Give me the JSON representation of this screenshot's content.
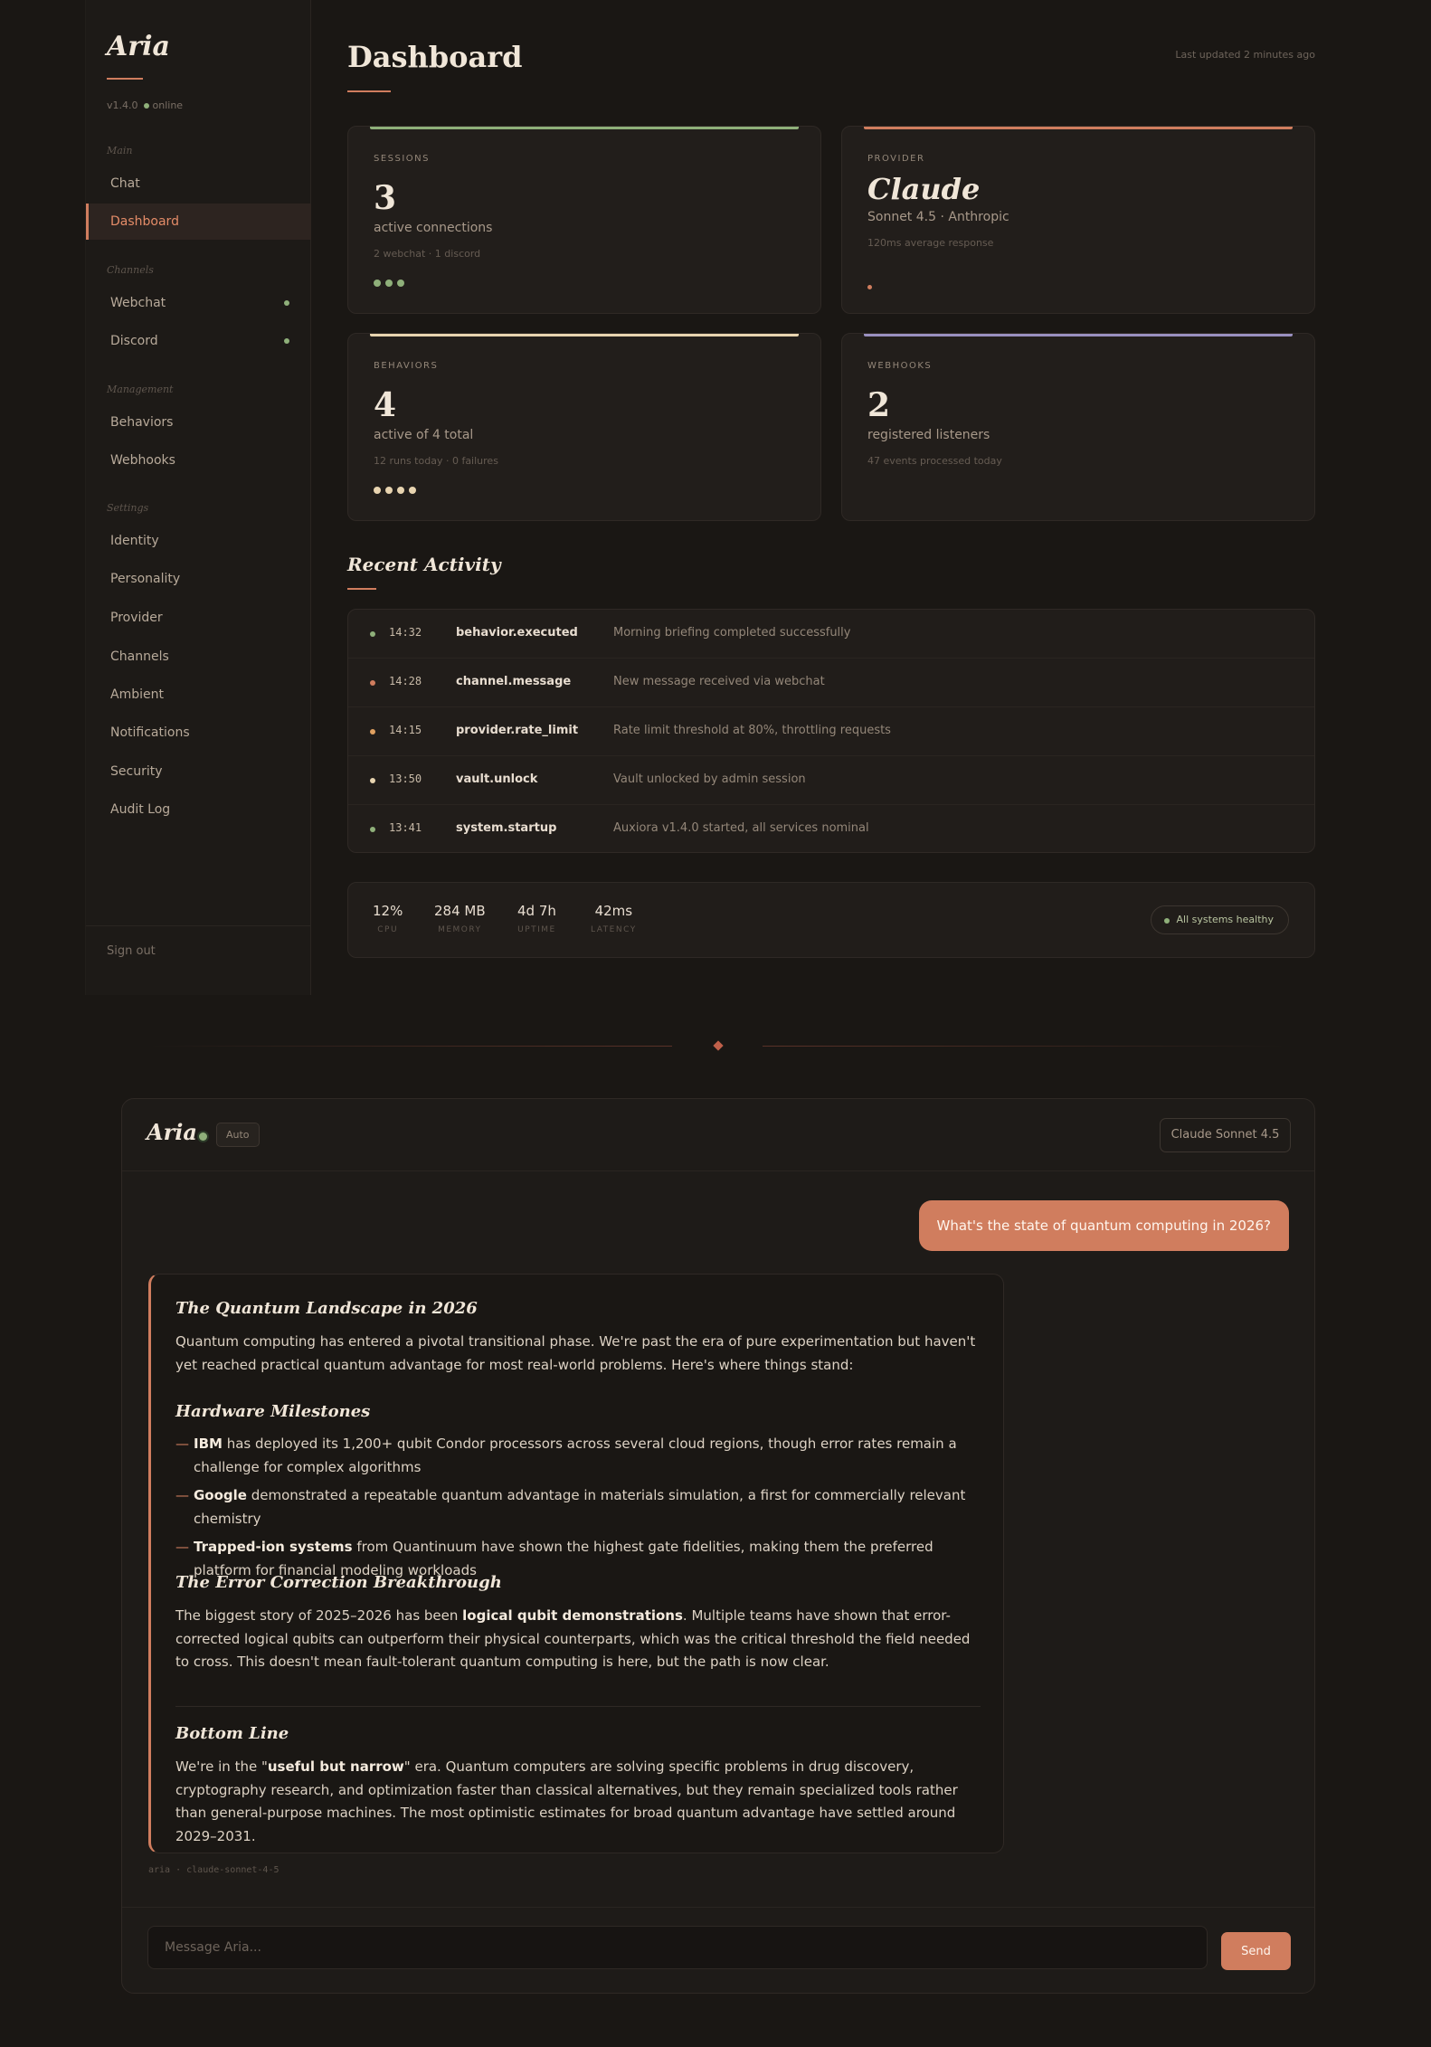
{
  "sidebar": {
    "brand": "Aria",
    "version": "v1.4.0",
    "status": "online",
    "sections": {
      "main": "Main",
      "channels": "Channels",
      "management": "Management",
      "settings": "Settings"
    },
    "items": [
      {
        "label": "Chat"
      },
      {
        "label": "Dashboard"
      },
      {
        "label": "Webchat"
      },
      {
        "label": "Discord"
      },
      {
        "label": "Behaviors"
      },
      {
        "label": "Webhooks"
      },
      {
        "label": "Identity"
      },
      {
        "label": "Personality"
      },
      {
        "label": "Provider"
      },
      {
        "label": "Channels"
      },
      {
        "label": "Ambient"
      },
      {
        "label": "Notifications"
      },
      {
        "label": "Security"
      },
      {
        "label": "Audit Log"
      }
    ],
    "sign_out": "Sign out"
  },
  "dashboard": {
    "title": "Dashboard",
    "last_updated": "Last updated 2 minutes ago",
    "cards": {
      "sessions": {
        "label": "SESSIONS",
        "value": "3",
        "sub": "active connections",
        "detail": "2 webchat · 1 discord",
        "accent": "#8fb07a"
      },
      "provider": {
        "label": "PROVIDER",
        "value": "Claude",
        "sub": "Sonnet 4.5 · Anthropic",
        "detail": "120ms average response",
        "accent": "#d07d5e"
      },
      "behaviors": {
        "label": "BEHAVIORS",
        "value": "4",
        "sub": "active of 4 total",
        "detail": "12 runs today · 0 failures",
        "accent": "#e8d4b0"
      },
      "webhooks": {
        "label": "WEBHOOKS",
        "value": "2",
        "sub": "registered listeners",
        "detail": "47 events processed today",
        "accent": "#9a90c0"
      }
    },
    "recent_title": "Recent Activity",
    "activity": [
      {
        "time": "14:32",
        "event": "behavior.executed",
        "desc": "Morning briefing completed successfully",
        "color": "#8fb07a"
      },
      {
        "time": "14:28",
        "event": "channel.message",
        "desc": "New message received via webchat",
        "color": "#d07d5e"
      },
      {
        "time": "14:15",
        "event": "provider.rate_limit",
        "desc": "Rate limit threshold at 80%, throttling requests",
        "color": "#e0a060"
      },
      {
        "time": "13:50",
        "event": "vault.unlock",
        "desc": "Vault unlocked by admin session",
        "color": "#e8d4b0"
      },
      {
        "time": "13:41",
        "event": "system.startup",
        "desc": "Auxiora v1.4.0 started, all services nominal",
        "color": "#8fb07a"
      }
    ],
    "stats": [
      {
        "value": "12%",
        "label": "CPU"
      },
      {
        "value": "284 MB",
        "label": "MEMORY"
      },
      {
        "value": "4d 7h",
        "label": "UPTIME"
      },
      {
        "value": "42ms",
        "label": "LATENCY"
      }
    ],
    "health": "All systems healthy"
  },
  "chat": {
    "brand": "Aria",
    "mode_badge": "Auto",
    "model": "Claude Sonnet 4.5",
    "user_message": "What's the state of quantum computing in 2026?",
    "response": {
      "h1": "The Quantum Landscape in 2026",
      "intro": "Quantum computing has entered a pivotal transitional phase. We're past the era of pure experimentation but haven't yet reached practical quantum advantage for most real-world problems. Here's where things stand:",
      "h2": "Hardware Milestones",
      "bullets": [
        {
          "strong": "IBM",
          "text": " has deployed its 1,200+ qubit Condor processors across several cloud regions, though error rates remain a challenge for complex algorithms"
        },
        {
          "strong": "Google",
          "text": " demonstrated a repeatable quantum advantage in materials simulation, a first for commercially relevant chemistry"
        },
        {
          "strong": "Trapped-ion systems",
          "text": " from Quantinuum have shown the highest gate fidelities, making them the preferred platform for financial modeling workloads"
        }
      ],
      "h3": "The Error Correction Breakthrough",
      "p2_a": "The biggest story of 2025–2026 has been ",
      "p2_strong": "logical qubit demonstrations",
      "p2_b": ". Multiple teams have shown that error-corrected logical qubits can outperform their physical counterparts, which was the critical threshold the field needed to cross. This doesn't mean fault-tolerant quantum computing is here, but the path is now clear.",
      "h4": "Bottom Line",
      "p3_a": "We're in the \"",
      "p3_strong": "useful but narrow",
      "p3_b": "\" era. Quantum computers are solving specific problems in drug discovery, cryptography research, and optimization faster than classical alternatives, but they remain specialized tools rather than general-purpose machines. The most optimistic estimates for broad quantum advantage have settled around 2029–2031."
    },
    "meta": "aria · claude-sonnet-4-5",
    "input_placeholder": "Message Aria...",
    "send_label": "Send"
  }
}
